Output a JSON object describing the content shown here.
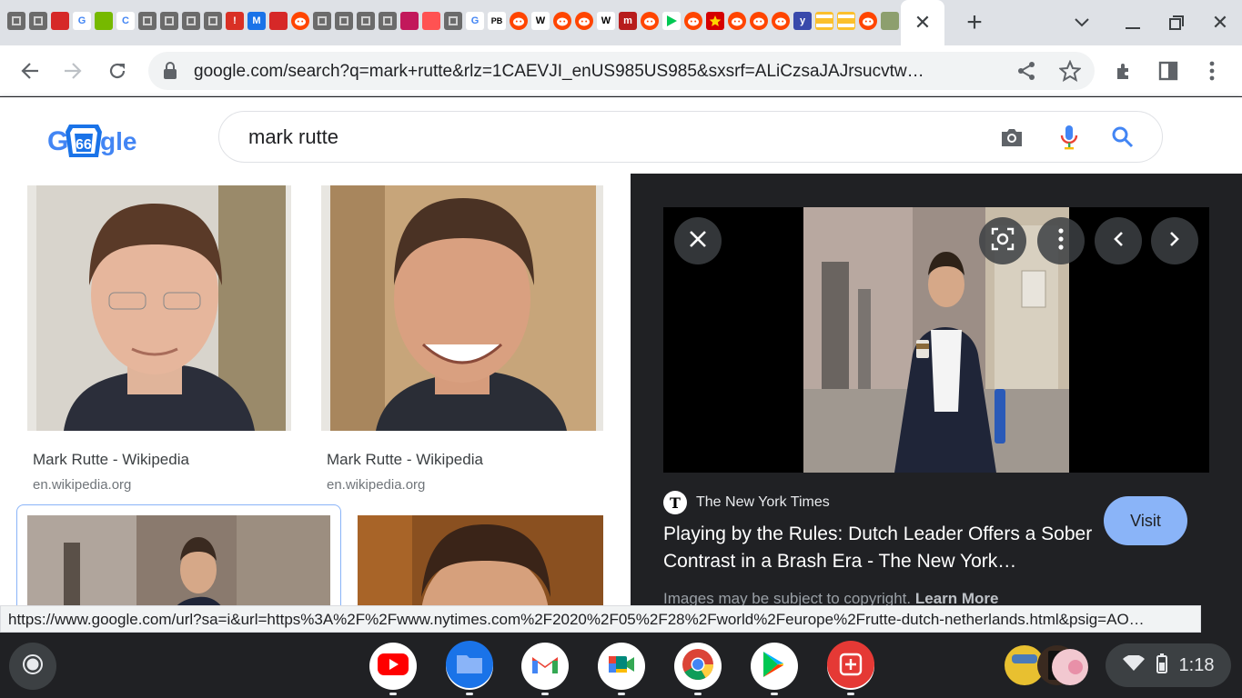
{
  "browser": {
    "tab_favicons": [
      {
        "icon": "doc-icon"
      },
      {
        "icon": "doc-icon"
      },
      {
        "icon": "mario-icon"
      },
      {
        "icon": "google-icon",
        "text": "G"
      },
      {
        "icon": "nvidia-icon"
      },
      {
        "icon": "chrome-c-icon",
        "text": "C"
      },
      {
        "icon": "doc-icon"
      },
      {
        "icon": "doc-icon"
      },
      {
        "icon": "doc-icon"
      },
      {
        "icon": "doc-icon"
      },
      {
        "icon": "alert-icon",
        "text": "!"
      },
      {
        "icon": "m-icon",
        "text": "M"
      },
      {
        "icon": "mario-icon"
      },
      {
        "icon": "reddit-icon"
      },
      {
        "icon": "doc-icon"
      },
      {
        "icon": "doc-icon"
      },
      {
        "icon": "doc-icon"
      },
      {
        "icon": "doc-icon"
      },
      {
        "icon": "cube-icon"
      },
      {
        "icon": "flame-icon"
      },
      {
        "icon": "doc-icon"
      },
      {
        "icon": "google-icon",
        "text": "G"
      },
      {
        "icon": "pb-icon",
        "text": "PB"
      },
      {
        "icon": "reddit-icon"
      },
      {
        "icon": "wikipedia-icon",
        "text": "W"
      },
      {
        "icon": "reddit-icon"
      },
      {
        "icon": "reddit-icon"
      },
      {
        "icon": "wikipedia-icon",
        "text": "W"
      },
      {
        "icon": "m-red-icon",
        "text": "m"
      },
      {
        "icon": "reddit-icon"
      },
      {
        "icon": "play-icon"
      },
      {
        "icon": "reddit-icon"
      },
      {
        "icon": "star-icon"
      },
      {
        "icon": "reddit-icon"
      },
      {
        "icon": "reddit-icon"
      },
      {
        "icon": "reddit-icon"
      },
      {
        "icon": "y-icon",
        "text": "y"
      },
      {
        "icon": "flag-icon"
      },
      {
        "icon": "flag-icon"
      },
      {
        "icon": "reddit-icon"
      },
      {
        "icon": "map-icon"
      },
      {
        "icon": "map-icon"
      }
    ],
    "url": "google.com/search?q=mark+rutte&rlz=1CAEVJI_enUS985US985&sxsrf=ALiCzsaJAJrsucvtw…",
    "status_url": "https://www.google.com/url?sa=i&url=https%3A%2F%2Fwww.nytimes.com%2F2020%2F05%2F28%2Fworld%2Feurope%2Frutte-dutch-netherlands.html&psig=AO…"
  },
  "google": {
    "logo_text": "G66gle",
    "query": "mark rutte"
  },
  "results": [
    {
      "title": "Mark Rutte - Wikipedia",
      "site": "en.wikipedia.org"
    },
    {
      "title": "Mark Rutte - Wikipedia",
      "site": "en.wikipedia.org"
    },
    {
      "title": "",
      "site": ""
    },
    {
      "title": "",
      "site": ""
    }
  ],
  "preview": {
    "source": "The New York Times",
    "source_logo": "T",
    "title": "Playing by the Rules: Dutch Leader Offers a Sober Contrast in a Brash Era - The New York…",
    "visit_label": "Visit",
    "copyright": "Images may be subject to copyright.",
    "learn_more": "Learn More"
  },
  "shelf": {
    "apps": [
      {
        "name": "YouTube",
        "icon": "youtube-icon",
        "color": "#ff0000"
      },
      {
        "name": "Files",
        "icon": "files-icon",
        "color": "#1a73e8"
      },
      {
        "name": "Gmail",
        "icon": "gmail-icon",
        "color": "#ffffff"
      },
      {
        "name": "Google Meet",
        "icon": "meet-icon",
        "color": "#ffffff"
      },
      {
        "name": "Chrome",
        "icon": "chrome-icon",
        "color": "#ffffff"
      },
      {
        "name": "Play Store",
        "icon": "play-store-icon",
        "color": "#ffffff"
      },
      {
        "name": "Screencast",
        "icon": "screencast-icon",
        "color": "#e53935"
      }
    ],
    "time": "1:18"
  }
}
